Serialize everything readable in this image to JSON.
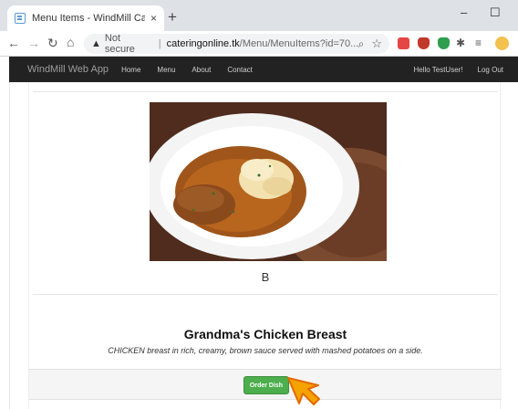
{
  "browser": {
    "tab_title": "Menu Items - WindMill Catering",
    "tab_close": "×",
    "new_tab": "+",
    "minimize": "–",
    "maximize": "☐",
    "address": {
      "security_label": "Not secure",
      "host": "cateringonline.tk",
      "path": "/Menu/MenuItems?id=70..."
    },
    "nav_icons": [
      "back-arrow-icon",
      "forward-arrow-icon",
      "reload-icon",
      "home-icon"
    ],
    "extension_colors": [
      "#e64545",
      "#c0392b",
      "#2e9e4f",
      "#444444",
      "#555555",
      "#f2c14e"
    ]
  },
  "navbar": {
    "brand": "WindMill Web App",
    "links": [
      "Home",
      "Menu",
      "About",
      "Contact"
    ],
    "greeting": "Hello TestUser!",
    "logout": "Log Out"
  },
  "menu_item": {
    "image_caption": "B",
    "name": "Grandma's Chicken Breast",
    "description": "CHICKEN breast in rich, creamy, brown sauce served with mashed potatoes on a side.",
    "order_button": "Order Dish"
  },
  "colors": {
    "navbar_bg": "#222222",
    "button_green": "#4cae4c",
    "cursor_fill": "#f4a300"
  }
}
